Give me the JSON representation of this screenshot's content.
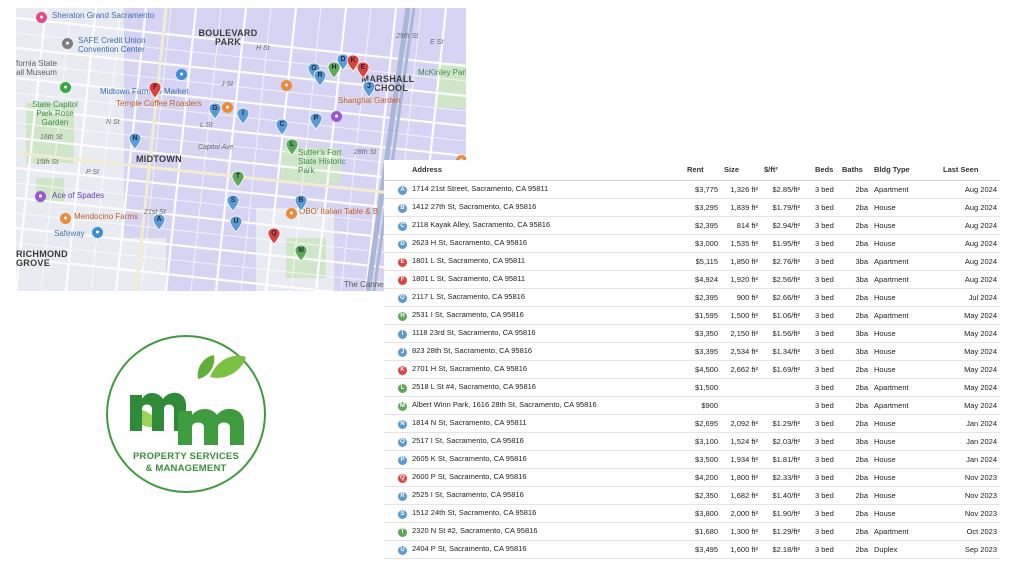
{
  "colors": {
    "pin_blue": "#5b9bd5",
    "pin_red": "#e0413b",
    "pin_green": "#5caa58",
    "logo_green": "#3f9a3f",
    "map_bg": "#e9ebf2",
    "map_highlight": "#c8c5ee"
  },
  "map": {
    "labels": {
      "sheraton": "Sheraton Grand Sacramento",
      "safe": "SAFE Credit Union Convention Center",
      "ca_state": "fornia State",
      "rail_museum": "ail Museum",
      "boulevard_park": "BOULEVARD PARK",
      "marshall_school": "MARSHALL SCHOOL",
      "mckinley": "McKinley Park",
      "shanghai": "Shanghai Garden",
      "midtown_farmers": "Midtown Farmers Market",
      "temple": "Temple Coffee Roasters",
      "capitol_park": "State Capitol Park Rose Garden",
      "midtown": "MIDTOWN",
      "suttersfort": "Sutter's Fort State Historic Park",
      "ace": "Ace of Spades",
      "mendocino": "Mendocino Farms",
      "obo": "OBO' Italian Table & B",
      "safeway": "Safeway",
      "richmond": "RICHMOND GROVE",
      "cannery": "The Canne",
      "st_h": "H St",
      "st_j": "J St",
      "st_l": "L St",
      "st_capitol": "Capitol Ave",
      "st_n": "N St",
      "st_p": "P St",
      "st_e": "E St",
      "st_21": "21st St",
      "st_28": "28th St",
      "st_29": "29th St",
      "st_16": "16th St",
      "st_15": "15th St"
    }
  },
  "logo": {
    "line1": "PROPERTY SERVICES",
    "line2": "& MANAGEMENT"
  },
  "table": {
    "headers": {
      "address": "Address",
      "rent": "Rent",
      "size": "Size",
      "psf": "$/ft²",
      "beds": "Beds",
      "baths": "Baths",
      "type": "Bldg Type",
      "seen": "Last Seen"
    },
    "rows": [
      {
        "pin": "A",
        "color": "blue",
        "address": "1714 21st Street, Sacramento, CA 95811",
        "rent": "$3,775",
        "size": "1,326 ft²",
        "psf": "$2.85/ft²",
        "beds": "3 bed",
        "baths": "2ba",
        "type": "Apartment",
        "seen": "Aug 2024"
      },
      {
        "pin": "B",
        "color": "blue",
        "address": "1412 27th St, Sacramento, CA 95816",
        "rent": "$3,295",
        "size": "1,839 ft²",
        "psf": "$1.79/ft²",
        "beds": "3 bed",
        "baths": "2ba",
        "type": "House",
        "seen": "Aug 2024"
      },
      {
        "pin": "C",
        "color": "blue",
        "address": "2118 Kayak Alley, Sacramento, CA 95816",
        "rent": "$2,395",
        "size": "814 ft²",
        "psf": "$2.94/ft²",
        "beds": "3 bed",
        "baths": "2ba",
        "type": "House",
        "seen": "Aug 2024"
      },
      {
        "pin": "D",
        "color": "blue",
        "address": "2623 H St, Sacramento, CA 95816",
        "rent": "$3,000",
        "size": "1,535 ft²",
        "psf": "$1.95/ft²",
        "beds": "3 bed",
        "baths": "2ba",
        "type": "House",
        "seen": "Aug 2024"
      },
      {
        "pin": "E",
        "color": "red",
        "address": "1801 L St, Sacramento, CA 95811",
        "rent": "$5,115",
        "size": "1,850 ft²",
        "psf": "$2.76/ft²",
        "beds": "3 bed",
        "baths": "3ba",
        "type": "Apartment",
        "seen": "Aug 2024"
      },
      {
        "pin": "F",
        "color": "red",
        "address": "1801 L St, Sacramento, CA 95811",
        "rent": "$4,924",
        "size": "1,920 ft²",
        "psf": "$2.56/ft²",
        "beds": "3 bed",
        "baths": "3ba",
        "type": "Apartment",
        "seen": "Aug 2024"
      },
      {
        "pin": "G",
        "color": "blue",
        "address": "2117 L St, Sacramento, CA 95816",
        "rent": "$2,395",
        "size": "900 ft²",
        "psf": "$2.66/ft²",
        "beds": "3 bed",
        "baths": "2ba",
        "type": "House",
        "seen": "Jul 2024"
      },
      {
        "pin": "H",
        "color": "green",
        "address": "2531 I St, Sacramento, CA 95816",
        "rent": "$1,595",
        "size": "1,500 ft²",
        "psf": "$1.06/ft²",
        "beds": "3 bed",
        "baths": "2ba",
        "type": "Apartment",
        "seen": "May 2024"
      },
      {
        "pin": "I",
        "color": "blue",
        "address": "1118 23rd St, Sacramento, CA 95816",
        "rent": "$3,350",
        "size": "2,150 ft²",
        "psf": "$1.56/ft²",
        "beds": "3 bed",
        "baths": "3ba",
        "type": "House",
        "seen": "May 2024"
      },
      {
        "pin": "J",
        "color": "blue",
        "address": "823 28th St, Sacramento, CA 95816",
        "rent": "$3,395",
        "size": "2,534 ft²",
        "psf": "$1.34/ft²",
        "beds": "3 bed",
        "baths": "3ba",
        "type": "House",
        "seen": "May 2024"
      },
      {
        "pin": "K",
        "color": "red",
        "address": "2701 H St, Sacramento, CA 95816",
        "rent": "$4,500",
        "size": "2,662 ft²",
        "psf": "$1.69/ft²",
        "beds": "3 bed",
        "baths": "2ba",
        "type": "House",
        "seen": "May 2024"
      },
      {
        "pin": "L",
        "color": "green",
        "address": "2518 L St #4, Sacramento, CA 95816",
        "rent": "$1,500",
        "size": "",
        "psf": "",
        "beds": "3 bed",
        "baths": "2ba",
        "type": "Apartment",
        "seen": "May 2024"
      },
      {
        "pin": "M",
        "color": "green",
        "address": "Albert Winn Park, 1616 28th St, Sacramento, CA 95816",
        "rent": "$900",
        "size": "",
        "psf": "",
        "beds": "3 bed",
        "baths": "2ba",
        "type": "Apartment",
        "seen": "May 2024"
      },
      {
        "pin": "N",
        "color": "blue",
        "address": "1814 N St, Sacramento, CA 95811",
        "rent": "$2,695",
        "size": "2,092 ft²",
        "psf": "$1.29/ft²",
        "beds": "3 bed",
        "baths": "2ba",
        "type": "House",
        "seen": "Jan 2024"
      },
      {
        "pin": "O",
        "color": "blue",
        "address": "2517 I St, Sacramento, CA 95816",
        "rent": "$3,100",
        "size": "1,524 ft²",
        "psf": "$2.03/ft²",
        "beds": "3 bed",
        "baths": "3ba",
        "type": "House",
        "seen": "Jan 2024"
      },
      {
        "pin": "P",
        "color": "blue",
        "address": "2605 K St, Sacramento, CA 95816",
        "rent": "$3,500",
        "size": "1,934 ft²",
        "psf": "$1.81/ft²",
        "beds": "3 bed",
        "baths": "2ba",
        "type": "House",
        "seen": "Jan 2024"
      },
      {
        "pin": "Q",
        "color": "red",
        "address": "2600 P St, Sacramento, CA 95816",
        "rent": "$4,200",
        "size": "1,800 ft²",
        "psf": "$2.33/ft²",
        "beds": "3 bed",
        "baths": "2ba",
        "type": "House",
        "seen": "Nov 2023"
      },
      {
        "pin": "R",
        "color": "blue",
        "address": "2525 I St, Sacramento, CA 95816",
        "rent": "$2,350",
        "size": "1,682 ft²",
        "psf": "$1.40/ft²",
        "beds": "3 bed",
        "baths": "2ba",
        "type": "House",
        "seen": "Nov 2023"
      },
      {
        "pin": "S",
        "color": "blue",
        "address": "1512 24th St, Sacramento, CA 95816",
        "rent": "$3,800",
        "size": "2,000 ft²",
        "psf": "$1.90/ft²",
        "beds": "3 bed",
        "baths": "2ba",
        "type": "House",
        "seen": "Nov 2023"
      },
      {
        "pin": "T",
        "color": "green",
        "address": "2320 N St #2, Sacramento, CA 95816",
        "rent": "$1,680",
        "size": "1,300 ft²",
        "psf": "$1.29/ft²",
        "beds": "3 bed",
        "baths": "2ba",
        "type": "Apartment",
        "seen": "Oct 2023"
      },
      {
        "pin": "U",
        "color": "blue",
        "address": "2404 P St, Sacramento, CA 95816",
        "rent": "$3,495",
        "size": "1,600 ft²",
        "psf": "$2.18/ft²",
        "beds": "3 bed",
        "baths": "2ba",
        "type": "Duplex",
        "seen": "Sep 2023"
      }
    ]
  }
}
